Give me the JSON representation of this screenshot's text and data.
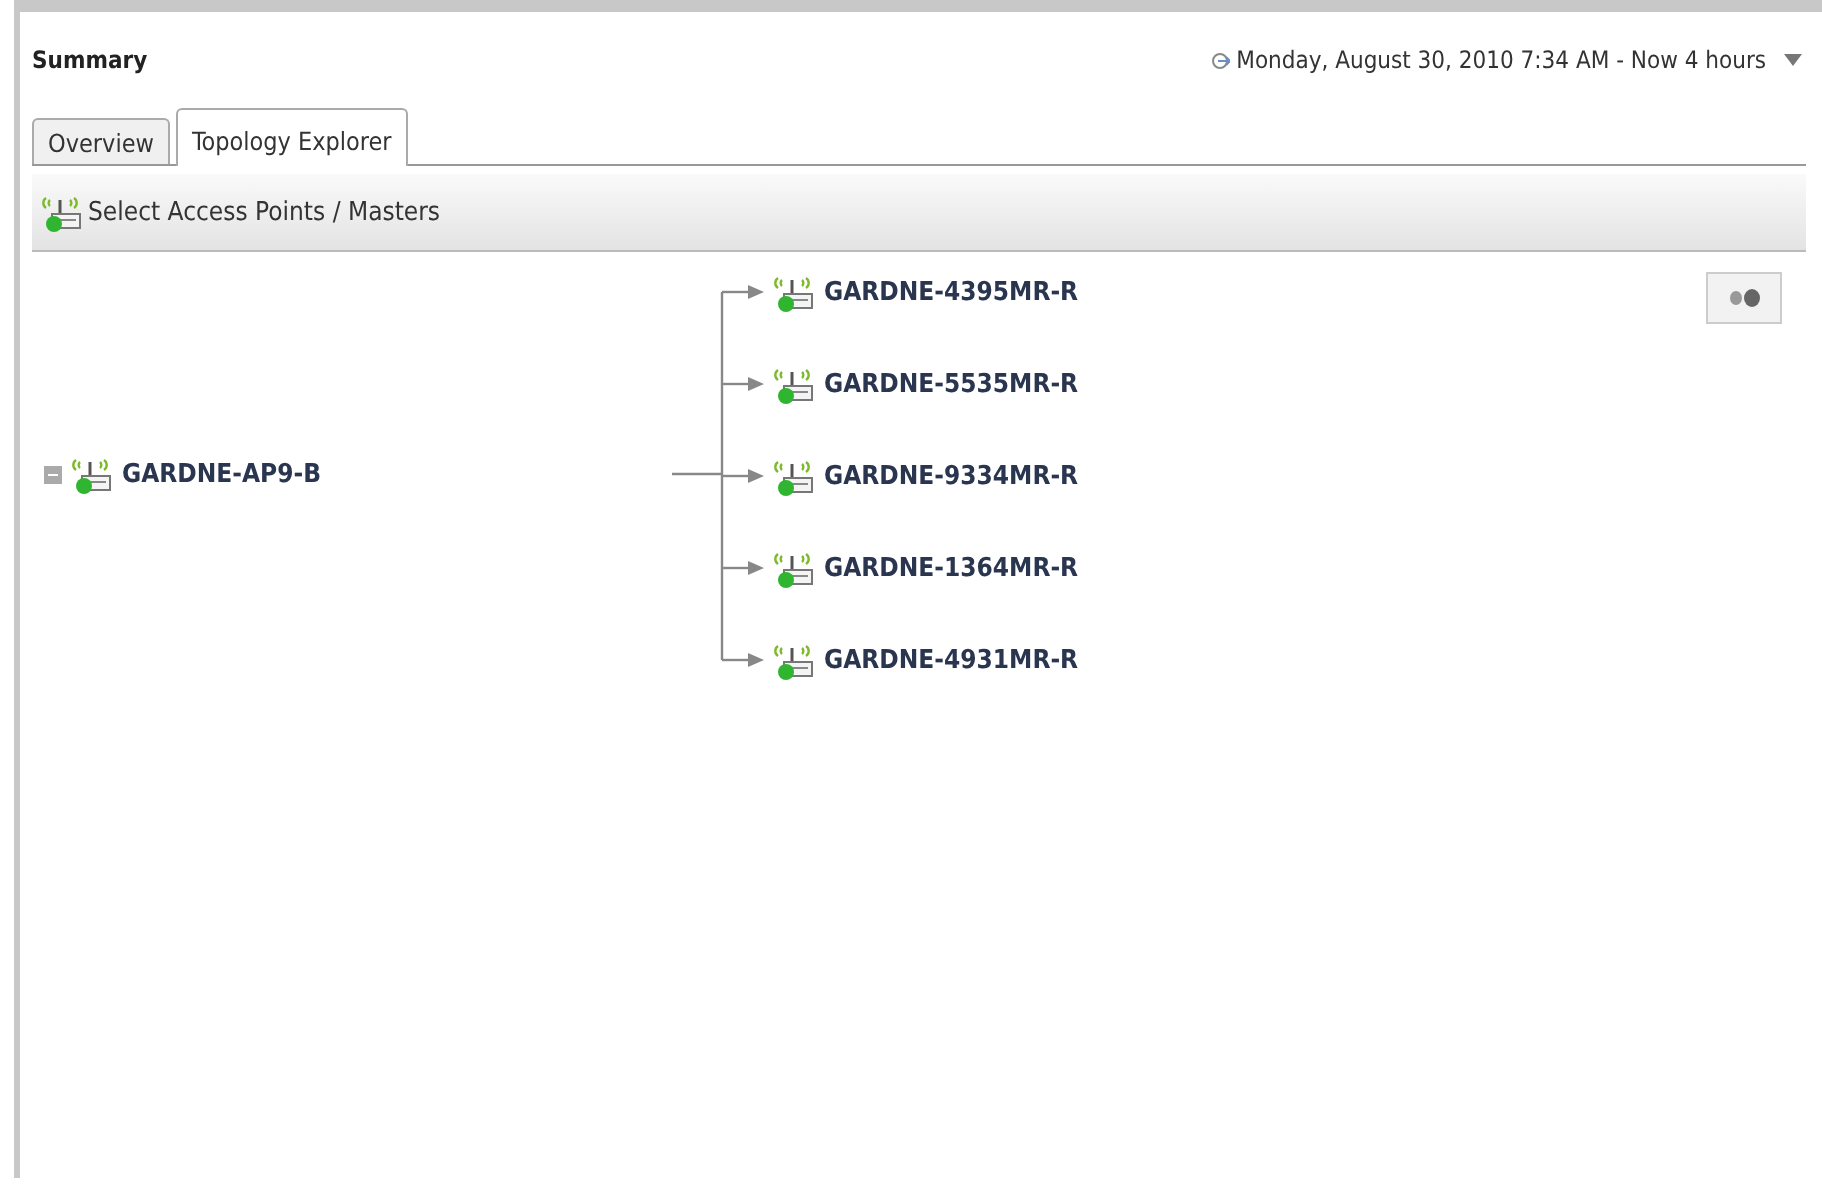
{
  "header": {
    "title": "Summary",
    "time_range": "Monday, August 30, 2010 7:34 AM - Now 4 hours"
  },
  "tabs": [
    {
      "label": "Overview",
      "selected": false
    },
    {
      "label": "Topology Explorer",
      "selected": true
    }
  ],
  "toolbar": {
    "button": "Select Access Points / Masters"
  },
  "topology": {
    "root": {
      "label": "GARDNE-AP9-B",
      "expanded": true,
      "children": [
        {
          "label": "GARDNE-4395MR-R"
        },
        {
          "label": "GARDNE-5535MR-R"
        },
        {
          "label": "GARDNE-9334MR-R"
        },
        {
          "label": "GARDNE-1364MR-R"
        },
        {
          "label": "GARDNE-4931MR-R"
        }
      ]
    }
  }
}
